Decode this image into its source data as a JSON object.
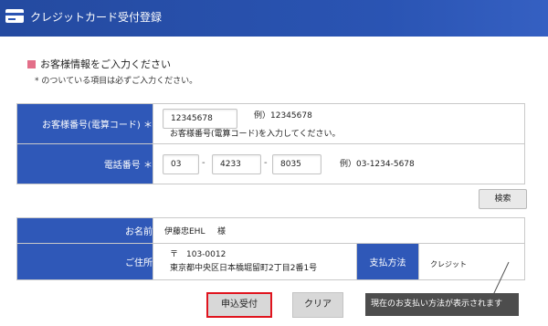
{
  "header": {
    "title": "クレジットカード受付登録"
  },
  "section": {
    "heading": "お客様情報をご入力ください",
    "note": "* のついている項目は必ずご入力ください。"
  },
  "customer_number": {
    "label": "お客様番号(電算コード) ＊",
    "value": "12345678",
    "example": "例）12345678",
    "hint": "お客様番号(電算コード)を入力してください。"
  },
  "phone": {
    "label": "電話番号 ＊",
    "part1": "03",
    "part2": "4233",
    "part3": "8035",
    "separator": "-",
    "example": "例）03-1234-5678"
  },
  "search_button": "検索",
  "name": {
    "label": "お名前",
    "value": "伊藤忠EHL",
    "honorific": "様"
  },
  "address": {
    "label": "ご住所",
    "postal": "〒　103-0012",
    "line": "東京都中央区日本橋堀留町2丁目2番1号"
  },
  "payment": {
    "label": "支払方法",
    "value": "クレジット"
  },
  "buttons": {
    "submit": "申込受付",
    "clear": "クリア"
  },
  "tooltip": "現在のお支払い方法が表示されます",
  "colors": {
    "header": "#2a54b3",
    "label_bg": "#2f58b8",
    "accent_square": "#e36f89",
    "highlight_border": "#e0141e"
  }
}
